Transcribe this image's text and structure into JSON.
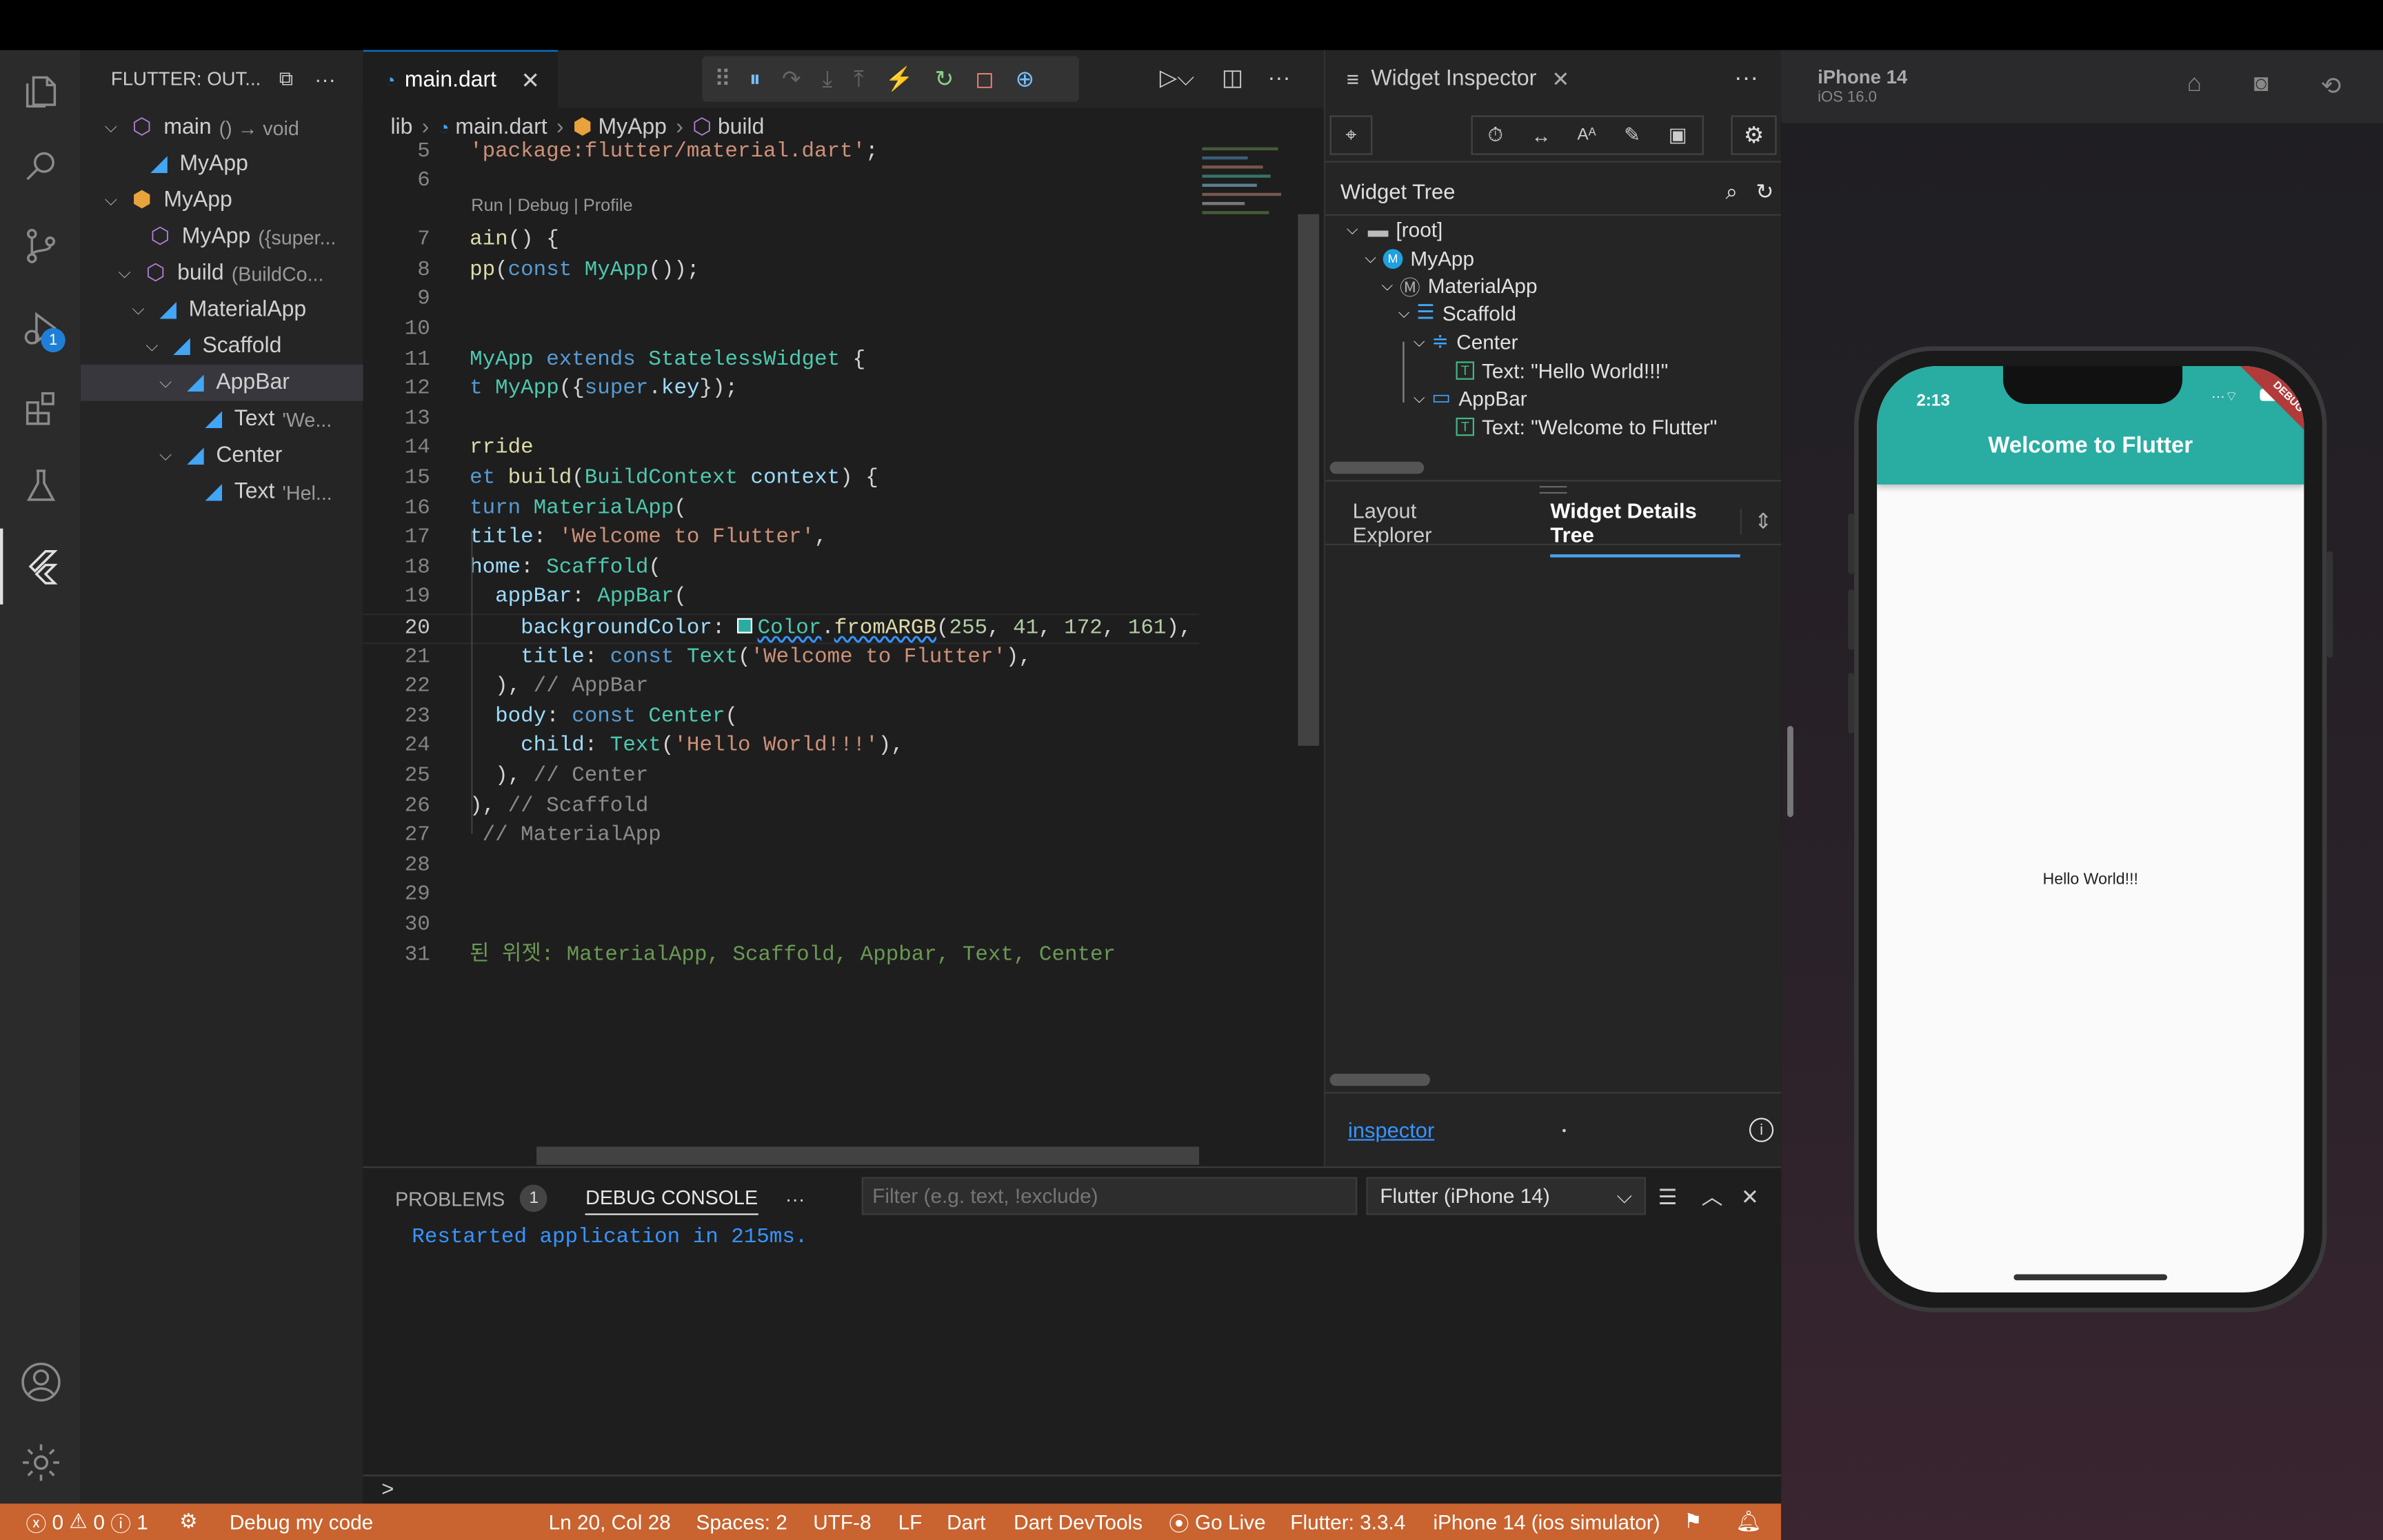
{
  "outline": {
    "title": "FLUTTER: OUT...",
    "items": [
      {
        "label": "main",
        "detail": "() → void"
      },
      {
        "label": "MyApp",
        "detail": ""
      },
      {
        "label": "MyApp",
        "detail": ""
      },
      {
        "label": "MyApp",
        "detail": "({super..."
      },
      {
        "label": "build",
        "detail": "(BuildCo..."
      },
      {
        "label": "MaterialApp",
        "detail": ""
      },
      {
        "label": "Scaffold",
        "detail": ""
      },
      {
        "label": "AppBar",
        "detail": ""
      },
      {
        "label": "Text",
        "detail": "'We..."
      },
      {
        "label": "Center",
        "detail": ""
      },
      {
        "label": "Text",
        "detail": "'Hel..."
      }
    ]
  },
  "editor": {
    "tab_label": "main.dart",
    "breadcrumb": [
      "lib",
      "main.dart",
      "MyApp",
      "build"
    ],
    "codelens": "Run | Debug | Profile",
    "line_numbers": [
      "5",
      "6",
      "7",
      "8",
      "9",
      "10",
      "11",
      "12",
      "13",
      "14",
      "15",
      "16",
      "17",
      "18",
      "19",
      "20",
      "21",
      "22",
      "23",
      "24",
      "25",
      "26",
      "27",
      "28",
      "29",
      "30",
      "31"
    ],
    "active_line": "20"
  },
  "inspector": {
    "tab_label": "Widget Inspector",
    "tree_title": "Widget Tree",
    "tree": [
      {
        "label": "[root]"
      },
      {
        "label": "MyApp"
      },
      {
        "label": "MaterialApp"
      },
      {
        "label": "Scaffold"
      },
      {
        "label": "Center"
      },
      {
        "label": "Text: \"Hello World!!!\""
      },
      {
        "label": "AppBar"
      },
      {
        "label": "Text: \"Welcome to Flutter\""
      }
    ],
    "tab_layout": "Layout Explorer",
    "tab_details": "Widget Details Tree",
    "link": "inspector",
    "dot": "•"
  },
  "panel": {
    "problems": "PROBLEMS",
    "problems_count": "1",
    "debug_console": "DEBUG CONSOLE",
    "more": "···",
    "filter_placeholder": "Filter (e.g. text, !exclude)",
    "device": "Flutter (iPhone 14)",
    "output": "Restarted application in 215ms.",
    "prompt": ">"
  },
  "status": {
    "errors": "0",
    "warnings": "0",
    "infos": "1",
    "debug": "Debug my code",
    "position": "Ln 20, Col 28",
    "spaces": "Spaces: 2",
    "encoding": "UTF-8",
    "eol": "LF",
    "language": "Dart",
    "devtools": "Dart DevTools",
    "golive": "Go Live",
    "flutter": "Flutter: 3.3.4",
    "device": "iPhone 14 (ios simulator)"
  },
  "simulator": {
    "device": "iPhone 14",
    "os": "iOS 16.0",
    "time": "2:13",
    "debug_ribbon": "DEBUG",
    "app_title": "Welcome to Flutter",
    "body_text": "Hello World!!!",
    "appbar_color": "#29ACA1"
  },
  "colors": {
    "statusbar": "#c9632f",
    "accent": "#0078d4"
  }
}
